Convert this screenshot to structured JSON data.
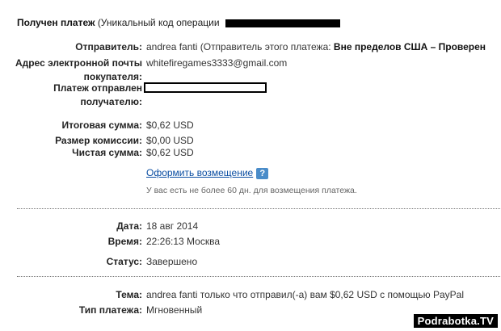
{
  "header": {
    "title": "Получен платеж",
    "subtitle": "(Уникальный код операции"
  },
  "sender": {
    "label": "Отправитель:",
    "name": "andrea fanti",
    "note_prefix": "(Отправитель этого платежа:",
    "note_status": "Вне пределов США – Проверен"
  },
  "buyer_email": {
    "label_line1": "Адрес электронной почты",
    "label_line2": "покупателя:",
    "value": "whitefiregames3333@gmail.com"
  },
  "sent_to": {
    "label_line1": "Платеж отправлен",
    "label_line2": "получателю:"
  },
  "amounts": {
    "total_label": "Итоговая сумма:",
    "total_value": "$0,62 USD",
    "fee_label": "Размер комиссии:",
    "fee_value": "$0,00 USD",
    "net_label": "Чистая сумма:",
    "net_value": "$0,62 USD"
  },
  "refund": {
    "link_label": "Оформить возмещение",
    "help_icon": "?",
    "note": "У вас есть не более 60 дн. для возмещения платежа."
  },
  "details": {
    "date_label": "Дата:",
    "date_value": "18 авг 2014",
    "time_label": "Время:",
    "time_value": "22:26:13 Москва",
    "status_label": "Статус:",
    "status_value": "Завершено"
  },
  "payment": {
    "subject_label": "Тема:",
    "subject_value": "andrea fanti только что отправил(-а) вам $0,62 USD с помощью PayPal",
    "type_label": "Тип платежа:",
    "type_value": "Мгновенный"
  },
  "watermark": "Podrabotka.TV"
}
